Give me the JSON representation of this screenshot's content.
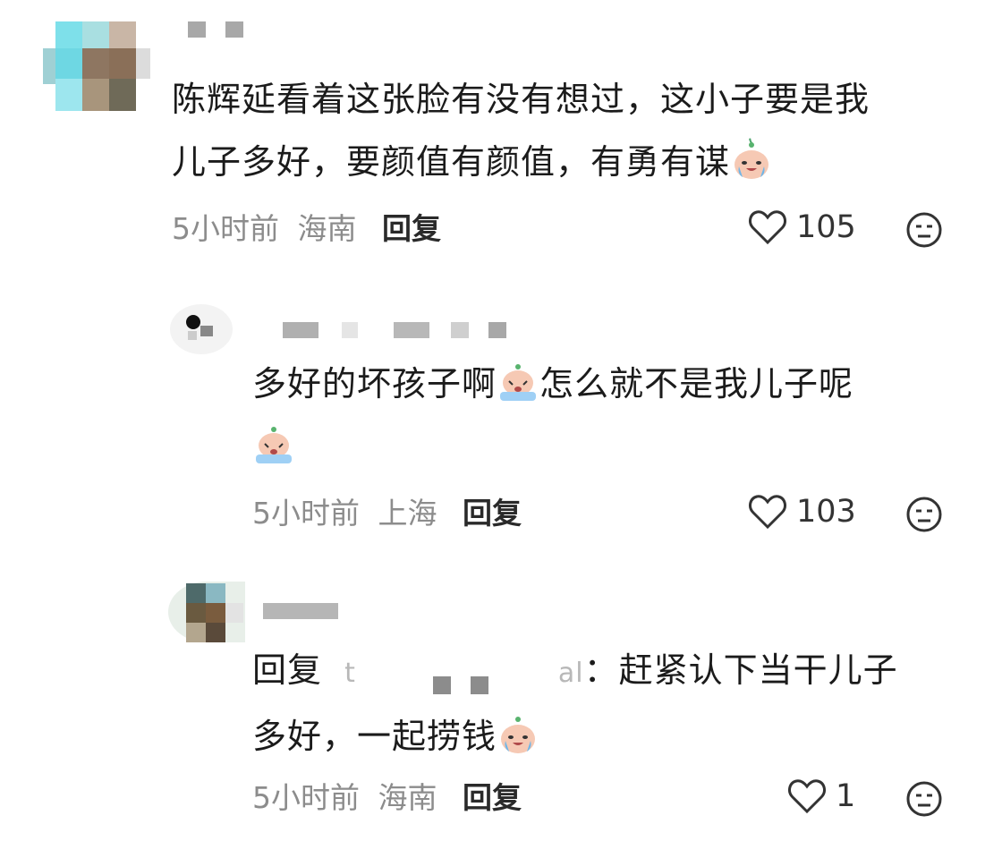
{
  "comments": [
    {
      "text_line1": "陈辉延看着这张脸有没有想过，这小子要是我",
      "text_line2": "儿子多好，要颜值有颜值，有勇有谋",
      "time": "5小时前",
      "location": "海南",
      "reply_label": "回复",
      "likes": "105"
    },
    {
      "text_line1": "多好的坏孩子啊",
      "text_line1b": "怎么就不是我儿子呢",
      "time": "5小时前",
      "location": "上海",
      "reply_label": "回复",
      "likes": "103"
    },
    {
      "reply_prefix": "回复",
      "reply_to_start": "t",
      "reply_to_end": "al",
      "text_line1": "：赶紧认下当干儿子",
      "text_line2": "多好，一起捞钱",
      "time": "5小时前",
      "location": "海南",
      "reply_label": "回复",
      "likes": "1"
    }
  ],
  "colors": {
    "text": "#1b1b1b",
    "meta": "#8c8c8c",
    "emoji_skin": "#f6c9b4",
    "emoji_tear": "#6fb6e8"
  },
  "icons": [
    "heart-icon",
    "dislike-face-icon",
    "crying-emoji-icon"
  ]
}
